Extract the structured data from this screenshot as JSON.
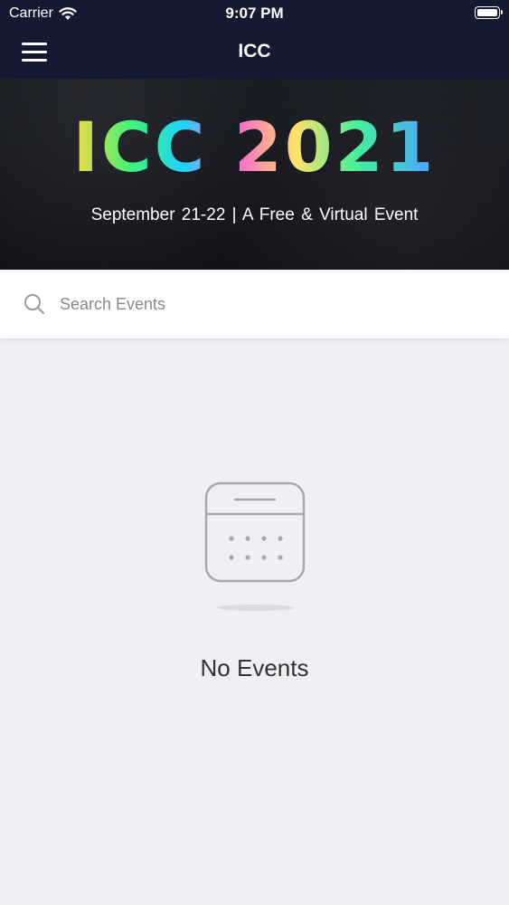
{
  "status_bar": {
    "carrier": "Carrier",
    "time": "9:07 PM"
  },
  "nav": {
    "title": "ICC",
    "menu_icon": "hamburger-menu-icon"
  },
  "banner": {
    "title": "ICC 2021",
    "subtitle": "September 21-22  |  A Free & Virtual Event"
  },
  "search": {
    "placeholder": "Search Events",
    "value": "",
    "icon": "search-icon"
  },
  "empty_state": {
    "icon": "calendar-icon",
    "message": "No Events"
  },
  "colors": {
    "header_background": "#141a32",
    "page_background": "#f0f0f4"
  }
}
